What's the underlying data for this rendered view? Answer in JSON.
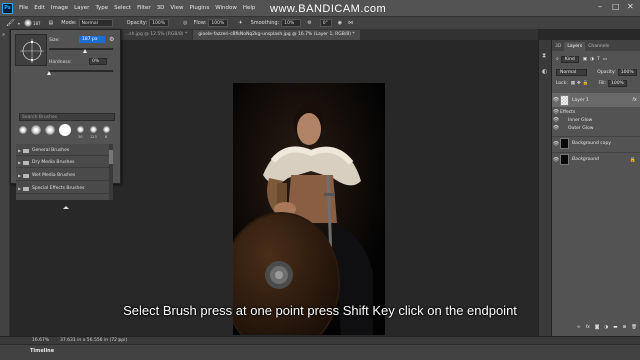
{
  "app": {
    "menu": [
      "File",
      "Edit",
      "Image",
      "Layer",
      "Type",
      "Select",
      "Filter",
      "3D",
      "View",
      "Plugins",
      "Window",
      "Help"
    ],
    "watermark": "www.BANDICAM.com"
  },
  "options_bar": {
    "brush_size": "187",
    "mode_label": "Mode:",
    "mode_value": "Normal",
    "opacity_label": "Opacity:",
    "opacity_value": "100%",
    "flow_label": "Flow:",
    "flow_value": "100%",
    "smoothing_label": "Smoothing:",
    "smoothing_value": "10%",
    "angle_value": "0°"
  },
  "tabs": [
    {
      "label": "...sh.jpg @ 12.5% (RGB/8) *",
      "active": false
    },
    {
      "label": "gioele-fazzeri-cBfkNoNq2kg-unsplash.jpg @ 16.7% (Layer 1, RGB/8) *",
      "active": true
    }
  ],
  "brush_panel": {
    "size_label": "Size:",
    "size_value": "187 px",
    "hardness_label": "Hardness:",
    "hardness_value": "0%",
    "search_placeholder": "Search Brushes",
    "tip_sizes": [
      "30",
      "123",
      "8",
      "10",
      "25",
      "112",
      "60"
    ],
    "folders": [
      "General Brushes",
      "Dry Media Brushes",
      "Wet Media Brushes",
      "Special Effects Brushes"
    ]
  },
  "layers_panel": {
    "tabs": [
      "3D",
      "Layers",
      "Channels"
    ],
    "kind_label": "Kind",
    "blend_mode": "Normal",
    "opacity_label": "Opacity:",
    "opacity_value": "100%",
    "fill_label": "Fill:",
    "fill_value": "100%",
    "lock_label": "Lock:",
    "layers": [
      {
        "name": "Layer 1",
        "fx": "fx"
      },
      {
        "name": "Effects"
      },
      {
        "name": "Inner Glow"
      },
      {
        "name": "Outer Glow"
      },
      {
        "name": "Background copy"
      },
      {
        "name": "Background"
      }
    ]
  },
  "status_bar": {
    "zoom": "16.67%",
    "doc_size": "37.631 in x 56.556 in (72 ppi)"
  },
  "timeline": {
    "label": "Timeline"
  },
  "caption": "Select Brush press at one point press Shift Key click on the endpoint"
}
